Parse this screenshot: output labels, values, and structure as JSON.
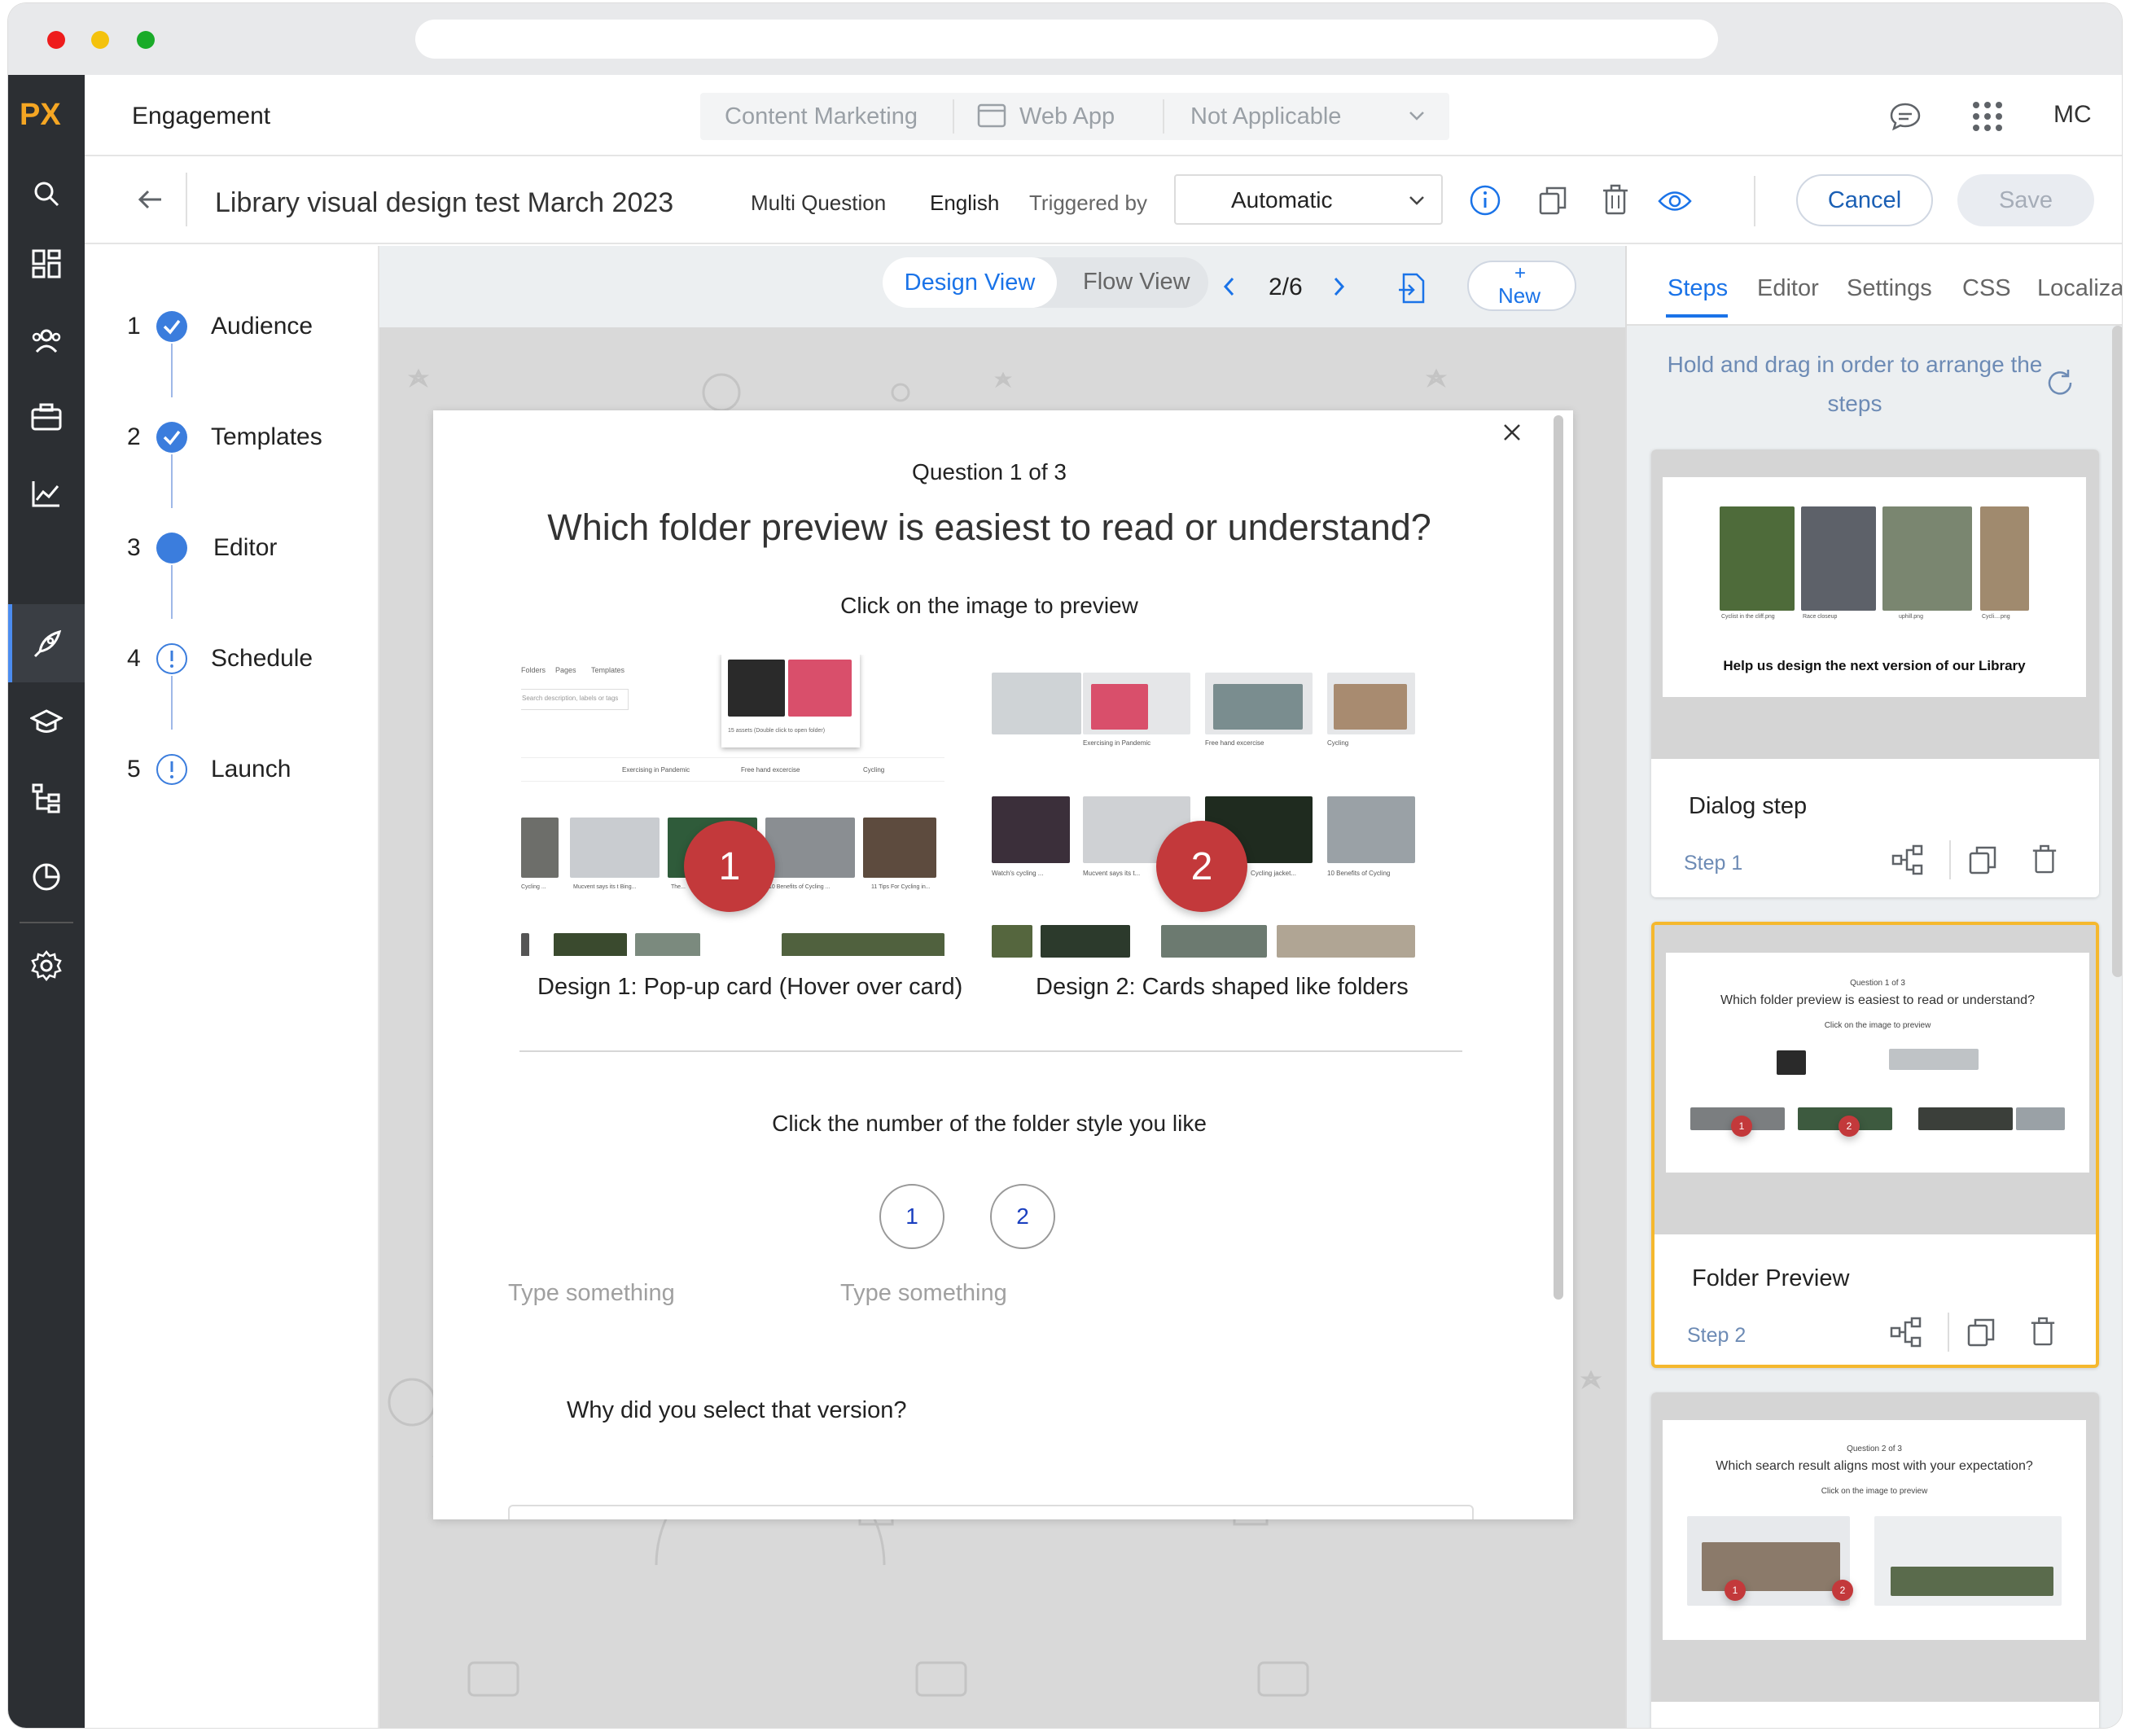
{
  "app": {
    "logo": "PX",
    "section": "Engagement"
  },
  "context_tabs": {
    "first": "Content Marketing",
    "second": "Web App",
    "third": "Not Applicable",
    "user_initials": "MC"
  },
  "toolbar": {
    "title": "Library visual design test March 2023",
    "type": "Multi Question",
    "language": "English",
    "triggered_label": "Triggered by",
    "trigger_value": "Automatic",
    "cancel": "Cancel",
    "save": "Save"
  },
  "wizard": {
    "steps": [
      {
        "num": "1",
        "label": "Audience",
        "state": "done"
      },
      {
        "num": "2",
        "label": "Templates",
        "state": "done"
      },
      {
        "num": "3",
        "label": "Editor",
        "state": "current"
      },
      {
        "num": "4",
        "label": "Schedule",
        "state": "warning"
      },
      {
        "num": "5",
        "label": "Launch",
        "state": "warning"
      }
    ]
  },
  "view": {
    "design": "Design View",
    "flow": "Flow View",
    "pager": "2/6",
    "new_plus": "+",
    "new_label": "New"
  },
  "dialog": {
    "counter": "Question 1 of 3",
    "question": "Which folder preview is easiest to read or understand?",
    "instruction": "Click on the image to preview",
    "design1": "Design 1: Pop-up card (Hover over card)",
    "design2": "Design 2: Cards shaped like folders",
    "badge1": "1",
    "badge2": "2",
    "rating_prompt": "Click the number of the folder style you like",
    "option1": "1",
    "option2": "2",
    "placeholder1": "Type something",
    "placeholder2": "Type something",
    "followup": "Why did you select that version?",
    "mini": {
      "tabs": [
        "Folders",
        "Pages",
        "Templates"
      ],
      "search": "Search description, labels or tags",
      "popup": "15 assets (Double click to open folder)",
      "row1": [
        "Exercising in Pandemic",
        "Free hand excercise",
        "Cycling"
      ],
      "row2": [
        "Cycling ...",
        "Mucvent says its t Bing...",
        "The...",
        "10 Benefits of Cycling ...",
        "11 Tips For Cycling in..."
      ],
      "f_row1": [
        "Exercising in Pandemic",
        "Free hand excercise",
        "Cycling"
      ],
      "f_row2": [
        "Watch's cycling ...",
        "Mucvent says its t...",
        "Cycling jacket...",
        "10 Benefits of Cycling"
      ]
    }
  },
  "panel": {
    "tabs": [
      "Steps",
      "Editor",
      "Settings",
      "CSS",
      "Localizat"
    ],
    "hint": "Hold and drag in order to arrange the steps",
    "cards": [
      {
        "name": "Dialog step",
        "step": "Step 1",
        "thumb_title": "Help us design the next version of our Library",
        "captions": [
          "Cyclist in the cliff.png",
          "Race closeup",
          "uphill.png",
          "Cycli....png"
        ]
      },
      {
        "name": "Folder Preview",
        "step": "Step 2",
        "thumb_counter": "Question 1 of 3",
        "thumb_q": "Which folder preview is easiest to read or understand?",
        "thumb_i": "Click on the image to preview",
        "b1": "1",
        "b2": "2"
      },
      {
        "thumb_counter": "Question 2 of 3",
        "thumb_q": "Which search result aligns most with your expectation?",
        "thumb_i": "Click on the image to preview",
        "b1": "1",
        "b2": "2"
      }
    ]
  },
  "colors": {
    "accent": "#1a73e8",
    "brand": "#f5a623",
    "badge": "#c3393b",
    "selected": "#f5b82e",
    "rail": "#2c2f33"
  }
}
